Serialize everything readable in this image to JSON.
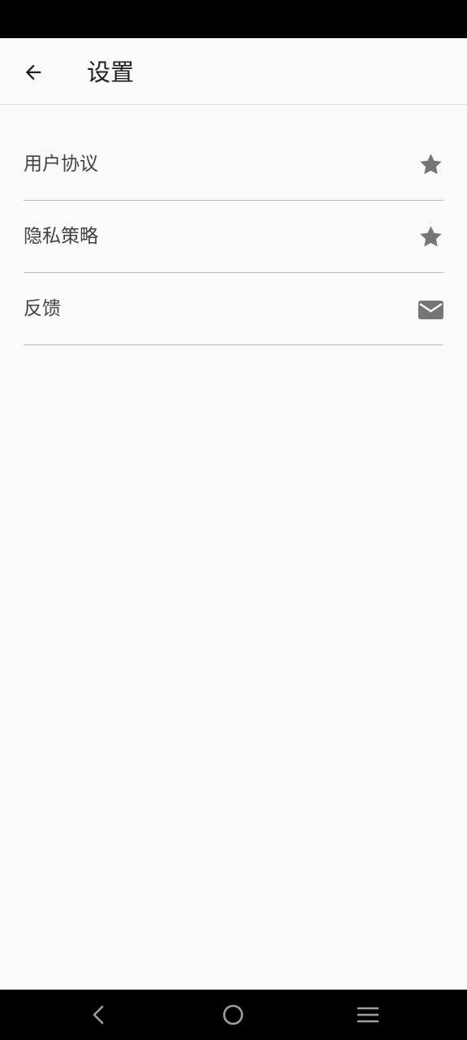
{
  "header": {
    "title": "设置",
    "back_icon": "arrow-left-icon"
  },
  "settings": {
    "items": [
      {
        "label": "用户协议",
        "icon": "star-icon"
      },
      {
        "label": "隐私策略",
        "icon": "star-icon"
      },
      {
        "label": "反馈",
        "icon": "envelope-icon"
      }
    ]
  },
  "navigation": {
    "back_icon": "triangle-back-icon",
    "home_icon": "circle-home-icon",
    "recents_icon": "menu-lines-icon"
  },
  "colors": {
    "background": "#fafafa",
    "title_text": "#212121",
    "item_text": "#424242",
    "icon_gray": "#757575",
    "divider": "#bdbdbd",
    "system_bar": "#000000"
  }
}
